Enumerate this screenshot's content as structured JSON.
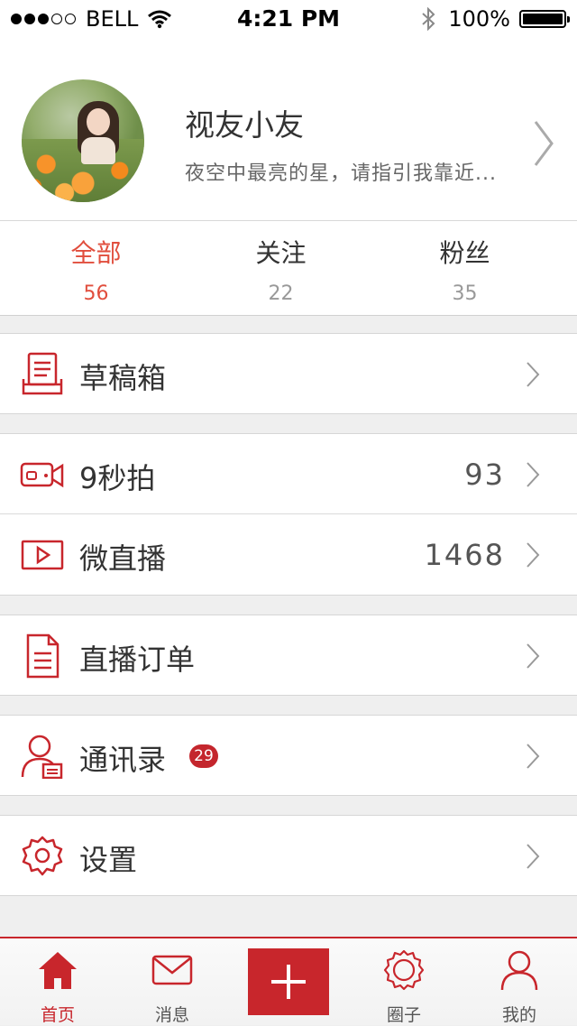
{
  "status_bar": {
    "carrier": "BELL",
    "signal_dots_full": 3,
    "signal_dots_total": 5,
    "time": "4:21 PM",
    "battery_percent": "100%",
    "icons": [
      "wifi-icon",
      "bluetooth-icon",
      "battery-icon"
    ]
  },
  "profile": {
    "name": "视友小友",
    "signature": "夜空中最亮的星，请指引我靠近..."
  },
  "stats": [
    {
      "label": "全部",
      "value": "56",
      "active": true
    },
    {
      "label": "关注",
      "value": "22",
      "active": false
    },
    {
      "label": "粉丝",
      "value": "35",
      "active": false
    }
  ],
  "menu": {
    "drafts": {
      "label": "草稿箱",
      "icon": "drafts-icon"
    },
    "nine_sec": {
      "label": "9秒拍",
      "value": "93",
      "icon": "video-camera-icon"
    },
    "micro_live": {
      "label": "微直播",
      "value": "1468",
      "icon": "live-play-icon"
    },
    "live_orders": {
      "label": "直播订单",
      "icon": "document-icon"
    },
    "contacts": {
      "label": "通讯录",
      "badge": "29",
      "icon": "contacts-icon"
    },
    "settings": {
      "label": "设置",
      "icon": "gear-icon"
    }
  },
  "tabbar": [
    {
      "label": "首页",
      "icon": "home-icon",
      "active": true
    },
    {
      "label": "消息",
      "icon": "mail-icon",
      "active": false
    },
    {
      "label": "",
      "icon": "plus-icon",
      "active": false
    },
    {
      "label": "圈子",
      "icon": "circle-gear-icon",
      "active": false
    },
    {
      "label": "我的",
      "icon": "person-icon",
      "active": false
    }
  ],
  "colors": {
    "accent": "#c8262c",
    "active_stat": "#e14e3d",
    "background": "#efefef"
  }
}
